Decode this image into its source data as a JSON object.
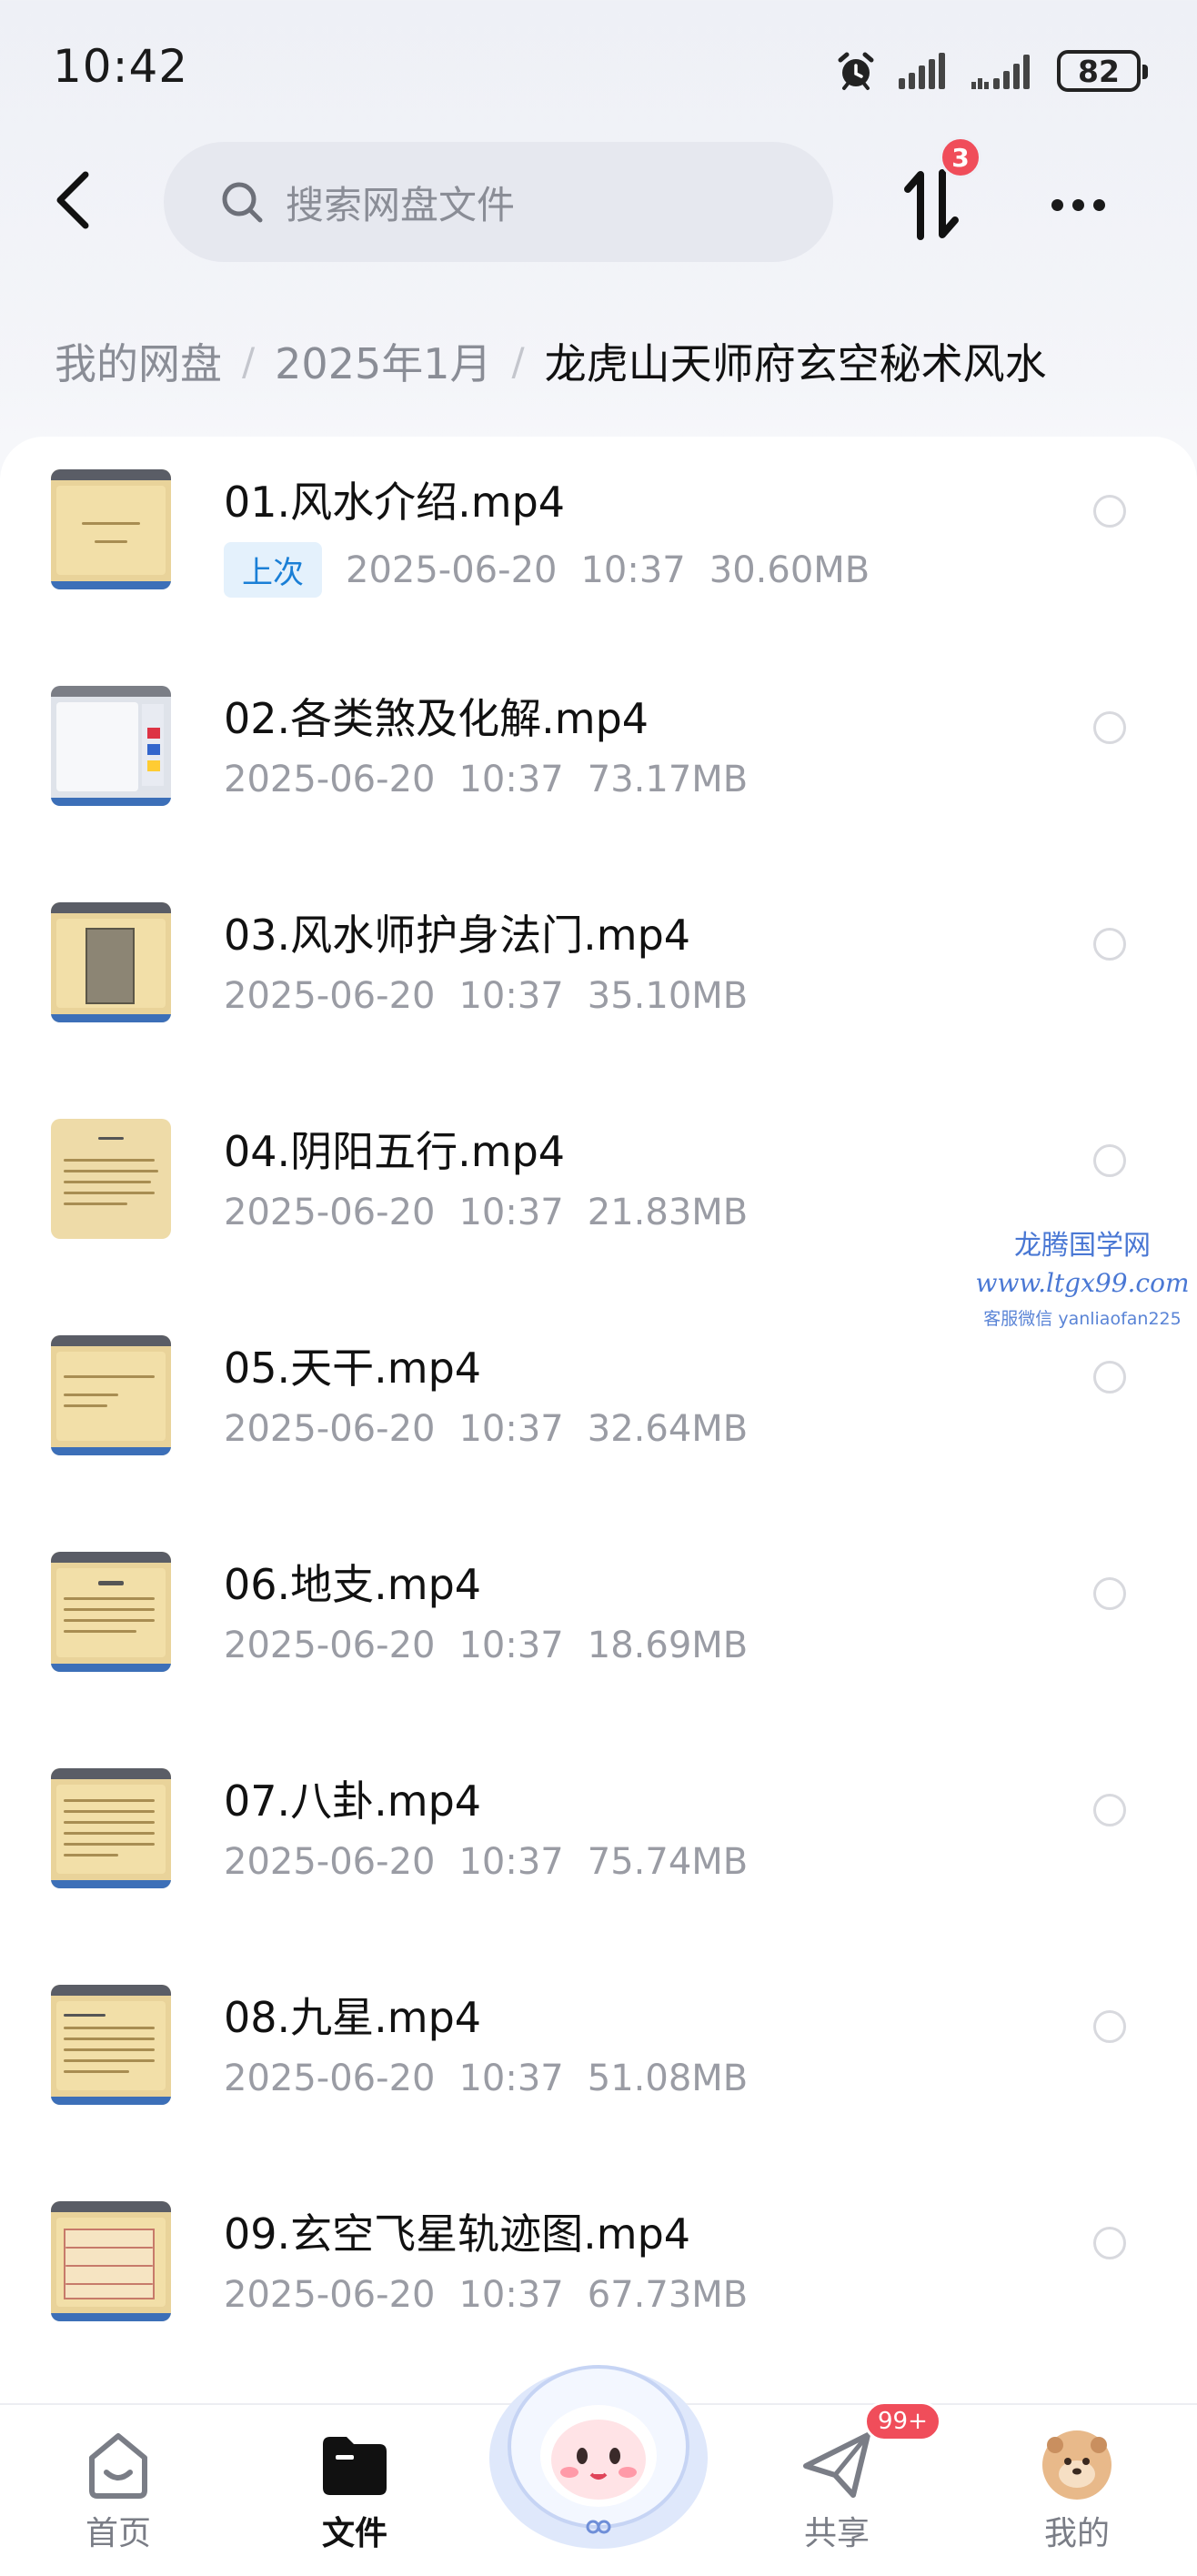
{
  "status_bar": {
    "time": "10:42",
    "battery": "82"
  },
  "header": {
    "search_placeholder": "搜索网盘文件",
    "transfer_badge": "3"
  },
  "breadcrumb": {
    "root": "我的网盘",
    "folder": "2025年1月",
    "current": "龙虎山天师府玄空秘术风水",
    "separator": "/"
  },
  "files": [
    {
      "name": "01.风水介绍.mp4",
      "tag": "上次",
      "date": "2025-06-20",
      "time": "10:37",
      "size": "30.60MB"
    },
    {
      "name": "02.各类煞及化解.mp4",
      "tag": "",
      "date": "2025-06-20",
      "time": "10:37",
      "size": "73.17MB"
    },
    {
      "name": "03.风水师护身法门.mp4",
      "tag": "",
      "date": "2025-06-20",
      "time": "10:37",
      "size": "35.10MB"
    },
    {
      "name": "04.阴阳五行.mp4",
      "tag": "",
      "date": "2025-06-20",
      "time": "10:37",
      "size": "21.83MB"
    },
    {
      "name": "05.天干.mp4",
      "tag": "",
      "date": "2025-06-20",
      "time": "10:37",
      "size": "32.64MB"
    },
    {
      "name": "06.地支.mp4",
      "tag": "",
      "date": "2025-06-20",
      "time": "10:37",
      "size": "18.69MB"
    },
    {
      "name": "07.八卦.mp4",
      "tag": "",
      "date": "2025-06-20",
      "time": "10:37",
      "size": "75.74MB"
    },
    {
      "name": "08.九星.mp4",
      "tag": "",
      "date": "2025-06-20",
      "time": "10:37",
      "size": "51.08MB"
    },
    {
      "name": "09.玄空飞星轨迹图.mp4",
      "tag": "",
      "date": "2025-06-20",
      "time": "10:37",
      "size": "67.73MB"
    }
  ],
  "watermark": {
    "title": "龙腾国学网",
    "url": "www.ltgx99.com",
    "contact": "客服微信 yanliaofan225"
  },
  "tabs": {
    "home": "首页",
    "files": "文件",
    "share": "共享",
    "mine": "我的",
    "share_badge": "99+"
  },
  "colors": {
    "accent": "#1a7fd6",
    "badge": "#f04d5a",
    "watermark": "#4a78d4"
  }
}
